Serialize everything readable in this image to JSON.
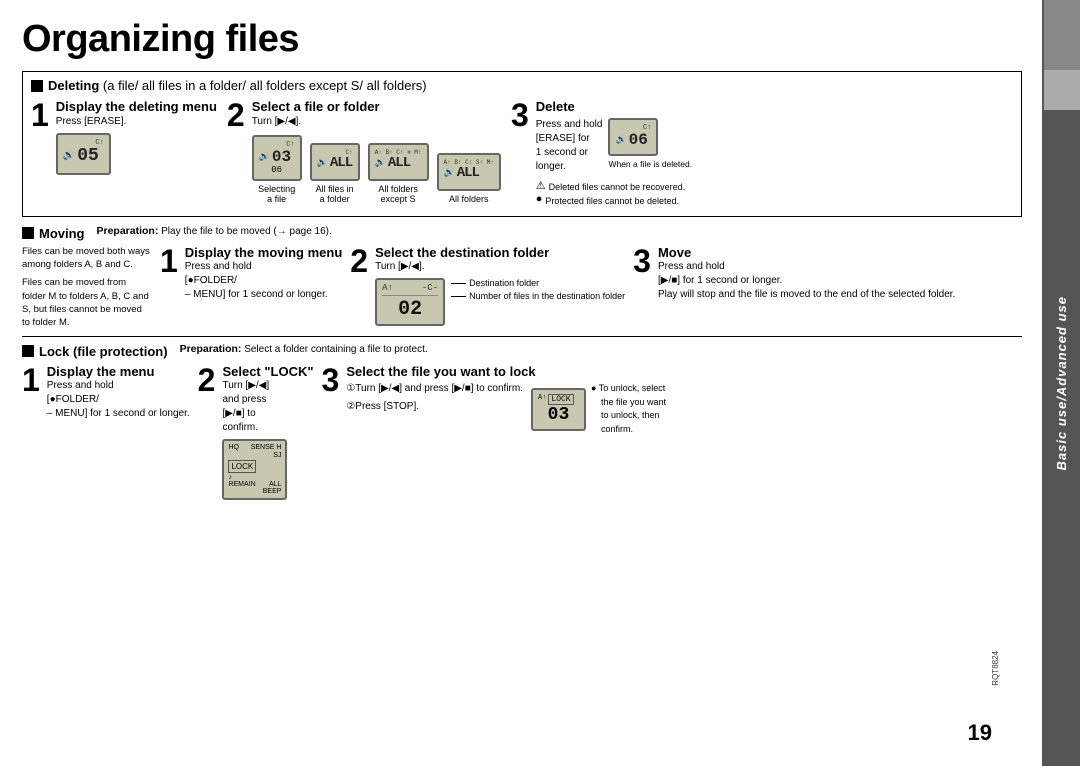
{
  "page": {
    "title": "Organizing files",
    "page_number": "19",
    "side_tab_text": "Basic use/Advanced use"
  },
  "deleting": {
    "section_title": "Deleting",
    "section_subtitle": "(a file/ all files in a folder/ all folders except S/ all folders)",
    "step1": {
      "num": "1",
      "title": "Display the deleting menu",
      "body": "Press [ERASE]."
    },
    "step2": {
      "num": "2",
      "title": "Select a file or folder",
      "body": "Turn [▶/◀]."
    },
    "step3": {
      "num": "3",
      "title": "Delete",
      "body1": "Press and hold",
      "body2": "[ERASE] for",
      "body3": "1 second or",
      "body4": "longer.",
      "body5": "When a file is deleted."
    },
    "displays": {
      "selecting_label": "Selecting\na file",
      "all_files_label": "All files in\na folder",
      "all_folders_ex_label": "All folders\nexcept S",
      "all_folders_label": "All folders"
    },
    "notes": {
      "note1": "Deleted files cannot be recovered.",
      "note2": "Protected files cannot be deleted."
    }
  },
  "moving": {
    "section_title": "Moving",
    "prep_text": "Preparation:",
    "prep_detail": "Play the file to be moved (→ page 16).",
    "left_text1": "Files can be moved both ways among folders A, B and C.",
    "left_text2": "Files can be moved from folder M to folders A, B, C and S, but files cannot be moved to folder M.",
    "step1": {
      "num": "1",
      "title": "Display the moving menu",
      "body1": "Press and hold",
      "body2": "[●FOLDER/",
      "body3": "– MENU] for 1 second or longer."
    },
    "step2": {
      "num": "2",
      "title": "Select the destination folder",
      "body": "Turn [▶/◀].",
      "dest_label": "Destination folder",
      "num_files_label": "Number of files in the destination folder"
    },
    "step3": {
      "num": "3",
      "title": "Move",
      "body1": "Press and hold",
      "body2": "[▶/■] for 1 second or longer.",
      "body3": "Play will stop and the file is moved to the end of the selected folder."
    }
  },
  "lock": {
    "section_title": "Lock (file protection)",
    "prep_text": "Preparation:",
    "prep_detail": "Select a folder containing a file to protect.",
    "step1": {
      "num": "1",
      "title": "Display the menu",
      "body1": "Press and hold",
      "body2": "[●FOLDER/",
      "body3": "– MENU] for 1 second or longer."
    },
    "step2": {
      "num": "2",
      "title": "Select \"LOCK\"",
      "body1": "Turn [▶/◀]",
      "body2": "and press",
      "body3": "[▶/■] to",
      "body4": "confirm.",
      "lcd_labels": [
        "HQ",
        "SENSE H",
        "SJ",
        "LOCK",
        "♪",
        "REMAIN",
        "ALL",
        "BEEP"
      ]
    },
    "step3": {
      "num": "3",
      "title": "Select the file you want to lock",
      "body1": "①Turn [▶/◀] and press [▶/■] to confirm.",
      "body2": "②Press [STOP].",
      "unlock_note1": "To unlock, select",
      "unlock_note2": "the file you want",
      "unlock_note3": "to unlock, then",
      "unlock_note4": "confirm."
    }
  }
}
